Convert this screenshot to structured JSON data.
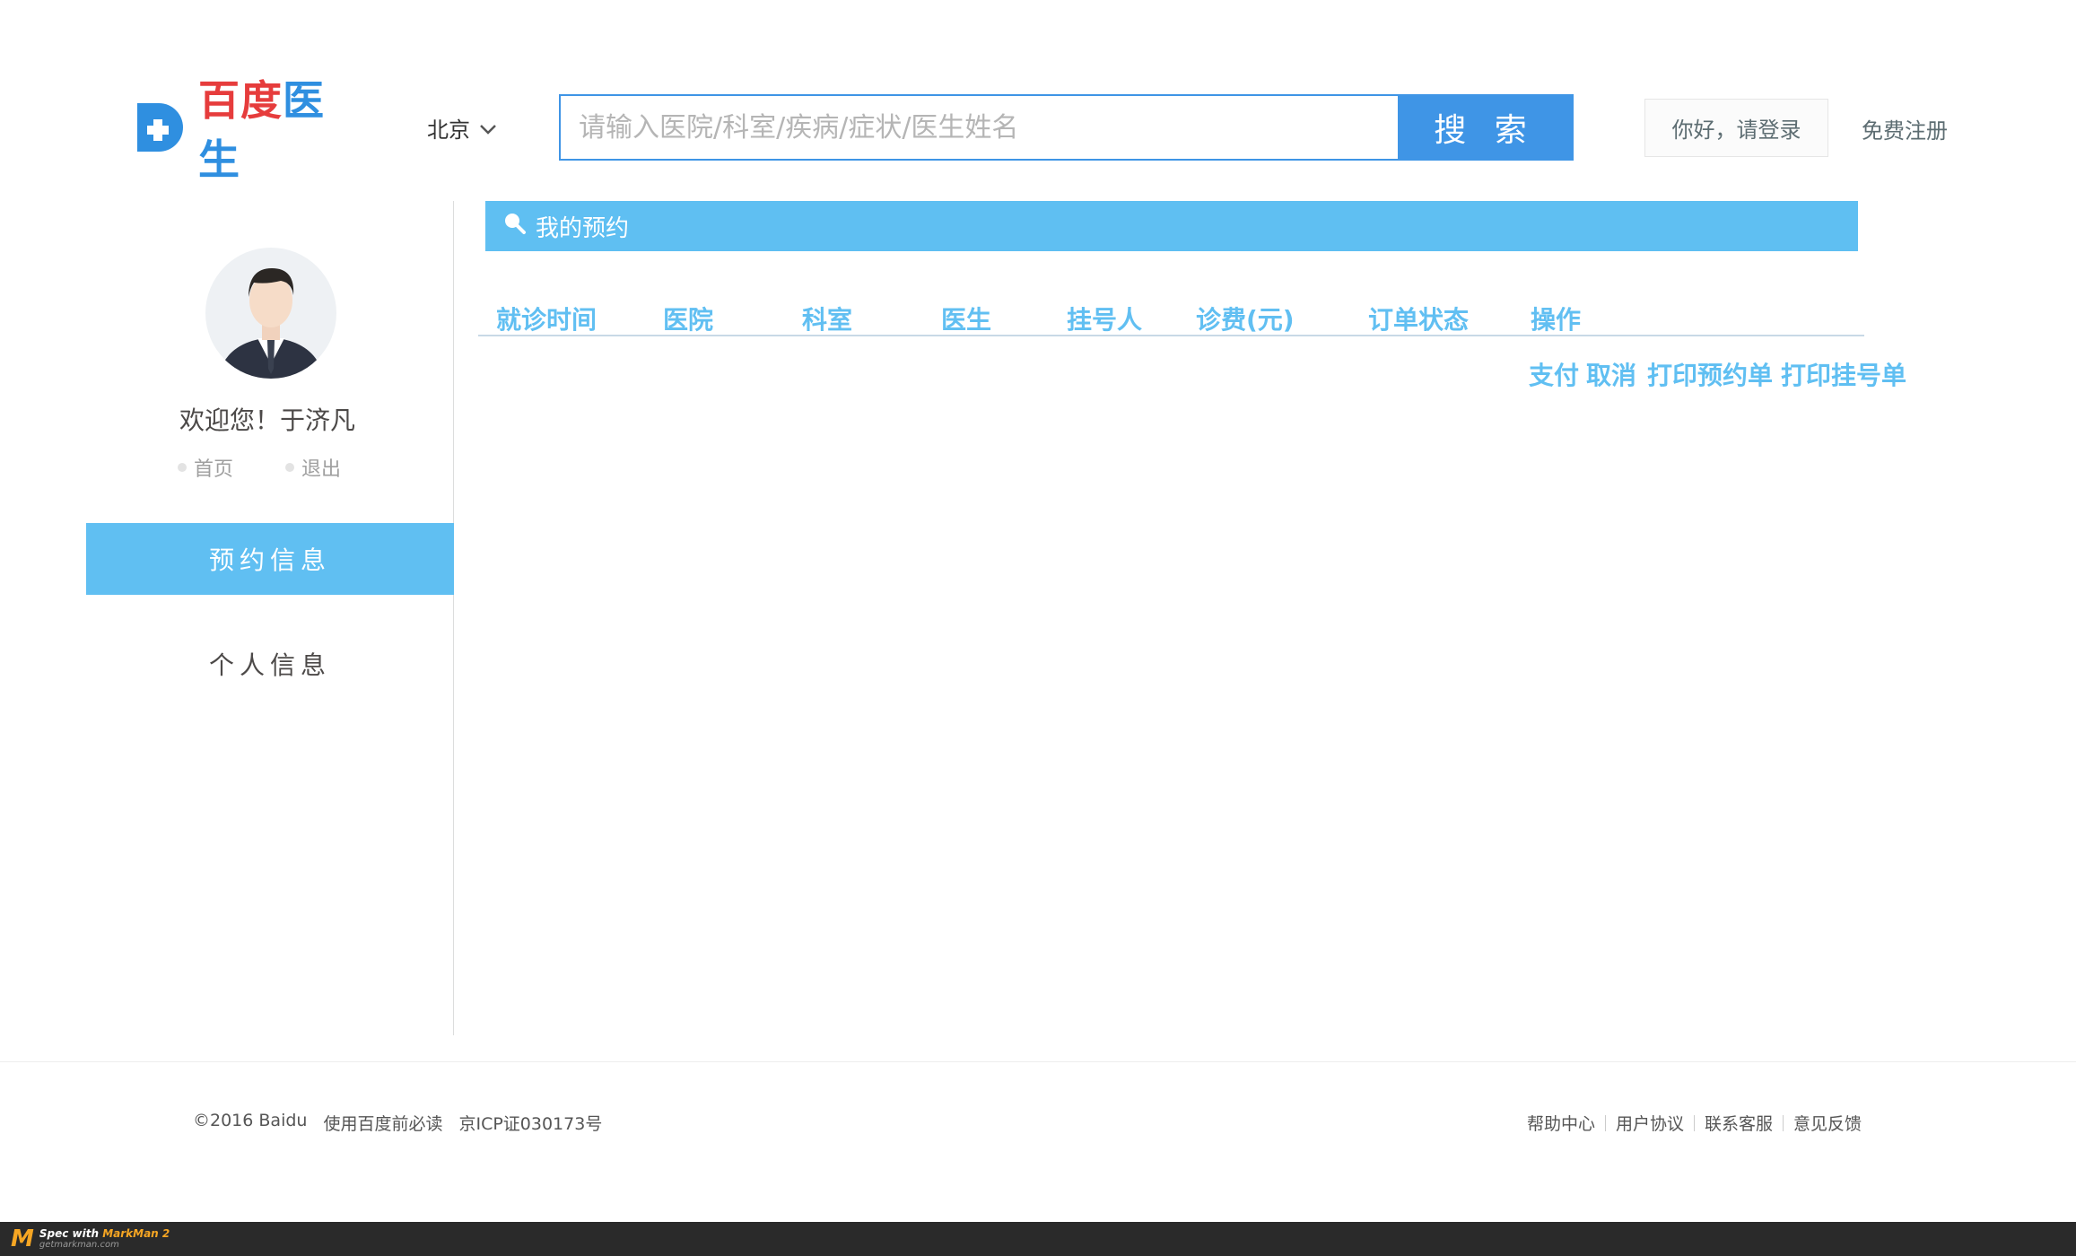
{
  "header": {
    "logo_text_part1": "百度",
    "logo_text_part2": "医生",
    "city": "北京",
    "search_placeholder": "请输入医院/科室/疾病/症状/医生姓名",
    "search_button": "搜 索",
    "login_button": "你好，请登录",
    "register_link": "免费注册"
  },
  "sidebar": {
    "welcome": "欢迎您！于济凡",
    "nav": [
      {
        "label": "首页"
      },
      {
        "label": "退出"
      }
    ],
    "items": [
      {
        "label": "预约信息",
        "active": true
      },
      {
        "label": "个人信息",
        "active": false
      }
    ]
  },
  "main": {
    "section_title": "我的预约",
    "columns": [
      "就诊时间",
      "医院",
      "科室",
      "医生",
      "挂号人",
      "诊费(元)",
      "订单状态",
      "操作"
    ],
    "actions": [
      "支付",
      "取消",
      "打印预约单",
      "打印挂号单"
    ]
  },
  "footer": {
    "copyright": "©2016 Baidu",
    "notice": "使用百度前必读",
    "icp": "京ICP证030173号",
    "links": [
      "帮助中心",
      "用户协议",
      "联系客服",
      "意见反馈"
    ]
  },
  "markbar": {
    "line1_prefix": "Spec with",
    "line1_brand": "MarkMan 2",
    "line2": "getmarkman.com"
  },
  "colors": {
    "brand_blue": "#3f95e6",
    "section_bar": "#5fbff2",
    "accent": "#60bff2",
    "text_dark": "#4c4948",
    "text_muted": "#9f9f9f",
    "login_bg": "#fbfbfb",
    "login_text": "#5d6d72",
    "divider": "#dcdddd"
  }
}
